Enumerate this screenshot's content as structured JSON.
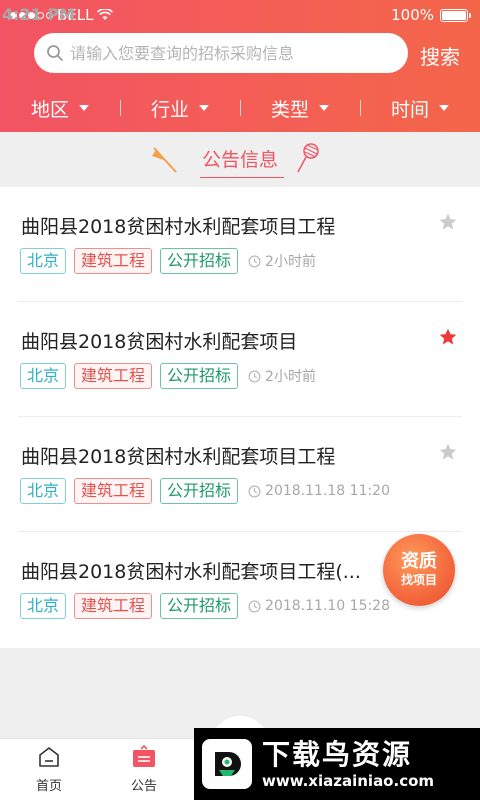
{
  "status_bar": {
    "carrier": "BELL",
    "time": "4:21 PM",
    "battery": "100%"
  },
  "search": {
    "placeholder": "请输入您要查询的招标采购信息",
    "button_label": "搜索"
  },
  "filters": [
    {
      "label": "地区"
    },
    {
      "label": "行业"
    },
    {
      "label": "类型"
    },
    {
      "label": "时间"
    }
  ],
  "section": {
    "title": "公告信息"
  },
  "items": [
    {
      "title": "曲阳县2018贫困村水利配套项目工程",
      "location": "北京",
      "category": "建筑工程",
      "type": "公开招标",
      "time": "2小时前",
      "starred": false
    },
    {
      "title": "曲阳县2018贫困村水利配套项目",
      "location": "北京",
      "category": "建筑工程",
      "type": "公开招标",
      "time": "2小时前",
      "starred": true
    },
    {
      "title": "曲阳县2018贫困村水利配套项目工程",
      "location": "北京",
      "category": "建筑工程",
      "type": "公开招标",
      "time": "2018.11.18 11:20",
      "starred": false
    },
    {
      "title": "曲阳县2018贫困村水利配套项目工程(...",
      "location": "北京",
      "category": "建筑工程",
      "type": "公开招标",
      "time": "2018.11.10 15:28",
      "starred": false
    }
  ],
  "fab": {
    "line1": "资质",
    "line2": "找项目"
  },
  "bottom_nav": [
    {
      "label": "首页"
    },
    {
      "label": "公告"
    }
  ],
  "watermark": {
    "name": "下载鸟资源",
    "url": "www.xiazainiao.com"
  },
  "colors": {
    "brand": "#f25463",
    "star_active": "#f03a3a",
    "star_inactive": "#cccccc"
  }
}
